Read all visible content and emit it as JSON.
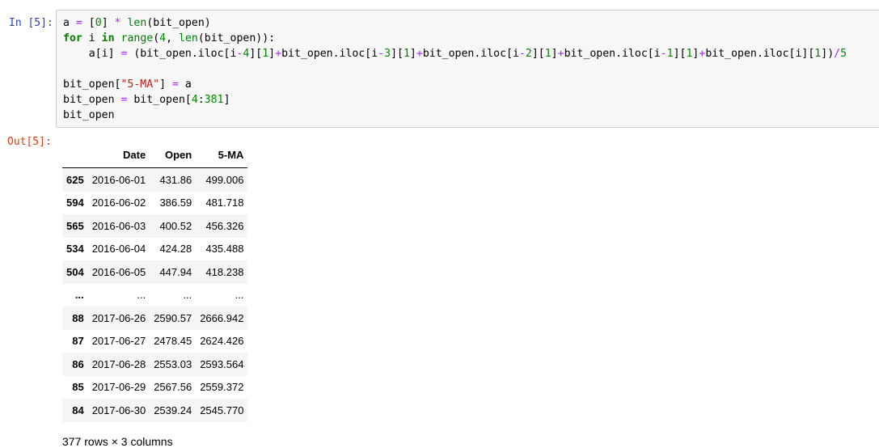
{
  "cell": {
    "in_prompt": "In [5]:",
    "out_prompt": "Out[5]:"
  },
  "code_lines": [
    [
      {
        "t": "a "
      },
      {
        "t": "=",
        "c": "o"
      },
      {
        "t": " ["
      },
      {
        "t": "0",
        "c": "n"
      },
      {
        "t": "] "
      },
      {
        "t": "*",
        "c": "o"
      },
      {
        "t": " "
      },
      {
        "t": "len",
        "c": "b"
      },
      {
        "t": "(bit_open)"
      }
    ],
    [
      {
        "t": "for",
        "c": "k"
      },
      {
        "t": " i "
      },
      {
        "t": "in",
        "c": "k"
      },
      {
        "t": " "
      },
      {
        "t": "range",
        "c": "b"
      },
      {
        "t": "("
      },
      {
        "t": "4",
        "c": "n"
      },
      {
        "t": ", "
      },
      {
        "t": "len",
        "c": "b"
      },
      {
        "t": "(bit_open)):"
      }
    ],
    [
      {
        "t": "    a[i] "
      },
      {
        "t": "=",
        "c": "o"
      },
      {
        "t": " (bit_open.iloc[i"
      },
      {
        "t": "-",
        "c": "o"
      },
      {
        "t": "4",
        "c": "n"
      },
      {
        "t": "]["
      },
      {
        "t": "1",
        "c": "n"
      },
      {
        "t": "]"
      },
      {
        "t": "+",
        "c": "o"
      },
      {
        "t": "bit_open.iloc[i"
      },
      {
        "t": "-",
        "c": "o"
      },
      {
        "t": "3",
        "c": "n"
      },
      {
        "t": "]["
      },
      {
        "t": "1",
        "c": "n"
      },
      {
        "t": "]"
      },
      {
        "t": "+",
        "c": "o"
      },
      {
        "t": "bit_open.iloc[i"
      },
      {
        "t": "-",
        "c": "o"
      },
      {
        "t": "2",
        "c": "n"
      },
      {
        "t": "]["
      },
      {
        "t": "1",
        "c": "n"
      },
      {
        "t": "]"
      },
      {
        "t": "+",
        "c": "o"
      },
      {
        "t": "bit_open.iloc[i"
      },
      {
        "t": "-",
        "c": "o"
      },
      {
        "t": "1",
        "c": "n"
      },
      {
        "t": "]["
      },
      {
        "t": "1",
        "c": "n"
      },
      {
        "t": "]"
      },
      {
        "t": "+",
        "c": "o"
      },
      {
        "t": "bit_open.iloc[i]["
      },
      {
        "t": "1",
        "c": "n"
      },
      {
        "t": "])"
      },
      {
        "t": "/",
        "c": "o"
      },
      {
        "t": "5",
        "c": "n"
      }
    ],
    [],
    [
      {
        "t": "bit_open["
      },
      {
        "t": "\"5-MA\"",
        "c": "s"
      },
      {
        "t": "] "
      },
      {
        "t": "=",
        "c": "o"
      },
      {
        "t": " a"
      }
    ],
    [
      {
        "t": "bit_open "
      },
      {
        "t": "=",
        "c": "o"
      },
      {
        "t": " bit_open["
      },
      {
        "t": "4",
        "c": "n"
      },
      {
        "t": ":"
      },
      {
        "t": "381",
        "c": "n"
      },
      {
        "t": "]"
      }
    ],
    [
      {
        "t": "bit_open"
      }
    ]
  ],
  "table": {
    "columns": [
      "",
      "Date",
      "Open",
      "5-MA"
    ],
    "rows": [
      {
        "index": "625",
        "cells": [
          "2016-06-01",
          "431.86",
          "499.006"
        ]
      },
      {
        "index": "594",
        "cells": [
          "2016-06-02",
          "386.59",
          "481.718"
        ]
      },
      {
        "index": "565",
        "cells": [
          "2016-06-03",
          "400.52",
          "456.326"
        ]
      },
      {
        "index": "534",
        "cells": [
          "2016-06-04",
          "424.28",
          "435.488"
        ]
      },
      {
        "index": "504",
        "cells": [
          "2016-06-05",
          "447.94",
          "418.238"
        ]
      },
      {
        "index": "...",
        "cells": [
          "...",
          "...",
          "..."
        ]
      },
      {
        "index": "88",
        "cells": [
          "2017-06-26",
          "2590.57",
          "2666.942"
        ]
      },
      {
        "index": "87",
        "cells": [
          "2017-06-27",
          "2478.45",
          "2624.426"
        ]
      },
      {
        "index": "86",
        "cells": [
          "2017-06-28",
          "2553.03",
          "2593.564"
        ]
      },
      {
        "index": "85",
        "cells": [
          "2017-06-29",
          "2567.56",
          "2559.372"
        ]
      },
      {
        "index": "84",
        "cells": [
          "2017-06-30",
          "2539.24",
          "2545.770"
        ]
      }
    ]
  },
  "footer": "377 rows × 3 columns"
}
